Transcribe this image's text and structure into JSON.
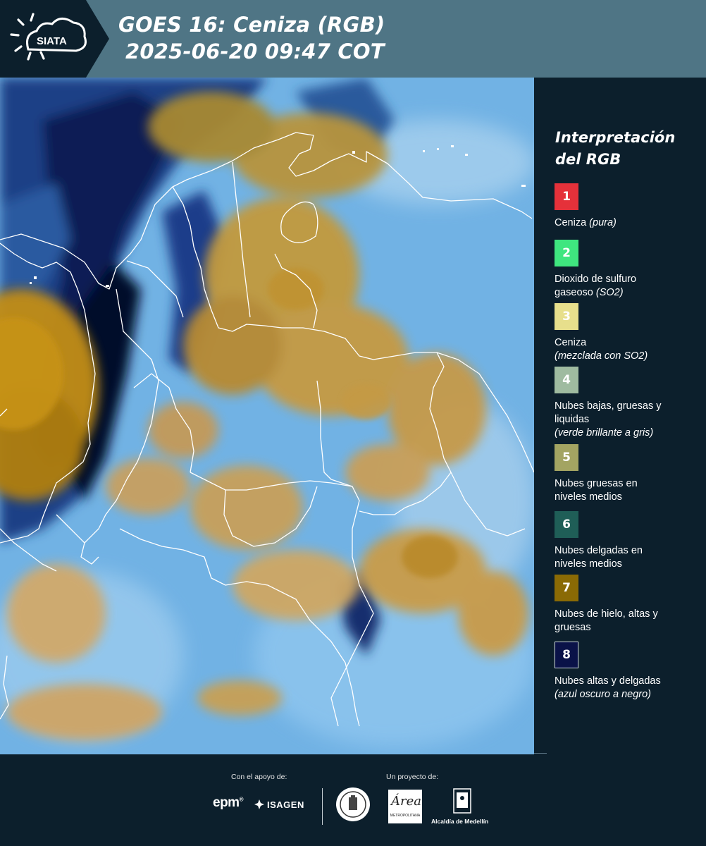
{
  "header": {
    "logo_text": "SIATA",
    "title_line1": "GOES 16: Ceniza (RGB)",
    "title_line2": "2025-06-20 09:47 COT",
    "background_color": "#4f7585"
  },
  "legend": {
    "title_line1": "Interpretación",
    "title_line2": "del RGB",
    "items": [
      {
        "number": "1",
        "color": "#e5313a",
        "text_lines": [
          "Ceniza"
        ],
        "italic_inline": "(pura)",
        "italic_lines": []
      },
      {
        "number": "2",
        "color": "#3fe67f",
        "text_lines": [
          "Dioxido de sulfuro",
          "gaseoso"
        ],
        "italic_inline": "(SO2)",
        "italic_lines": []
      },
      {
        "number": "3",
        "color": "#e7df8c",
        "text_lines": [
          "Ceniza"
        ],
        "italic_inline": "",
        "italic_lines": [
          "(mezclada con SO2)"
        ]
      },
      {
        "number": "4",
        "color": "#9fbba0",
        "text_lines": [
          "Nubes bajas, gruesas y",
          "liquidas"
        ],
        "italic_inline": "",
        "italic_lines": [
          "(verde brillante a gris)"
        ]
      },
      {
        "number": "5",
        "color": "#a3a462",
        "text_lines": [
          "Nubes gruesas en",
          "niveles medios"
        ],
        "italic_inline": "",
        "italic_lines": []
      },
      {
        "number": "6",
        "color": "#1f5e57",
        "text_lines": [
          "Nubes delgadas en",
          "niveles medios"
        ],
        "italic_inline": "",
        "italic_lines": []
      },
      {
        "number": "7",
        "color": "#8a6a05",
        "text_lines": [
          "Nubes de hielo, altas y",
          "gruesas"
        ],
        "italic_inline": "",
        "italic_lines": []
      },
      {
        "number": "8",
        "color": "#0a1248",
        "text_lines": [
          "Nubes altas y delgadas"
        ],
        "italic_inline": "",
        "italic_lines": [
          "(azul oscuro a negro)"
        ]
      }
    ]
  },
  "footer": {
    "support_label": "Con el apoyo de:",
    "project_label": "Un proyecto de:",
    "epm": "epm",
    "isagen": "ISAGEN",
    "area_title": "Área",
    "area_subtitle": "METROPOLITANA",
    "alcaldia": "Alcaldía de Medellín"
  }
}
